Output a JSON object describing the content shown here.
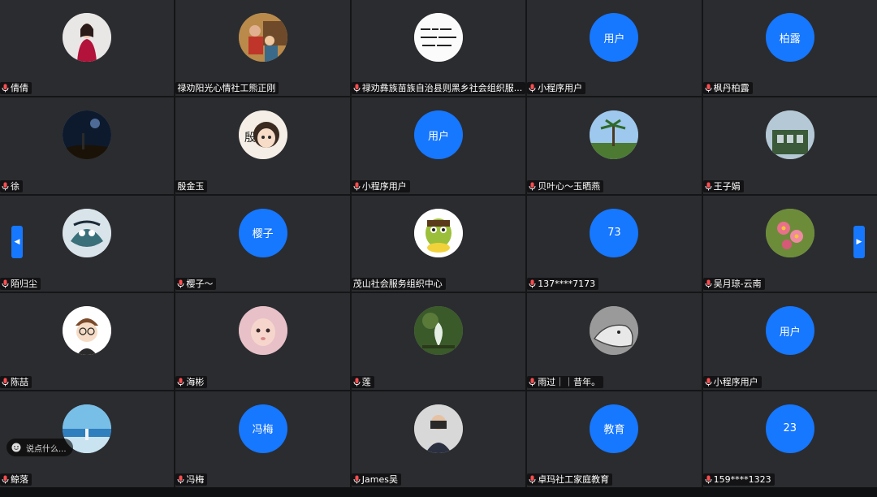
{
  "participants": [
    {
      "name": "倩倩",
      "mic": true,
      "avatar": {
        "kind": "photo",
        "icon": "woman-red-dress-photo"
      }
    },
    {
      "name": "禄劝阳光心情社工熊正刚",
      "mic": false,
      "avatar": {
        "kind": "photo",
        "icon": "people-office-photo"
      }
    },
    {
      "name": "禄劝彝族苗族自治县则黑乡社会组织服...",
      "mic": true,
      "avatar": {
        "kind": "photo",
        "icon": "handwriting-photo"
      }
    },
    {
      "name": "小程序用户",
      "mic": true,
      "avatar": {
        "kind": "text",
        "text": "用户"
      }
    },
    {
      "name": "枫丹柏露",
      "mic": true,
      "avatar": {
        "kind": "text",
        "text": "柏露"
      }
    },
    {
      "name": "徐",
      "mic": true,
      "avatar": {
        "kind": "photo",
        "icon": "night-sky-photo"
      }
    },
    {
      "name": "殷金玉",
      "mic": false,
      "avatar": {
        "kind": "photo",
        "icon": "cartoon-girl-photo"
      }
    },
    {
      "name": "小程序用户",
      "mic": true,
      "avatar": {
        "kind": "text",
        "text": "用户"
      }
    },
    {
      "name": "贝叶心～玉晒燕",
      "mic": true,
      "avatar": {
        "kind": "photo",
        "icon": "palm-tree-photo"
      }
    },
    {
      "name": "王子娟",
      "mic": true,
      "avatar": {
        "kind": "photo",
        "icon": "building-photo"
      }
    },
    {
      "name": "陌归尘",
      "mic": true,
      "avatar": {
        "kind": "photo",
        "icon": "tiger-art-photo"
      }
    },
    {
      "name": "樱子～",
      "mic": true,
      "avatar": {
        "kind": "text",
        "text": "樱子"
      }
    },
    {
      "name": "茂山社会服务组织中心",
      "mic": false,
      "avatar": {
        "kind": "photo",
        "icon": "cartoon-character-photo"
      }
    },
    {
      "name": "137****7173",
      "mic": true,
      "avatar": {
        "kind": "text",
        "text": "73"
      }
    },
    {
      "name": "吴月琼-云南",
      "mic": true,
      "avatar": {
        "kind": "photo",
        "icon": "flowers-photo"
      }
    },
    {
      "name": "陈喆",
      "mic": true,
      "avatar": {
        "kind": "photo",
        "icon": "cartoon-boy-photo"
      }
    },
    {
      "name": "海彬",
      "mic": true,
      "avatar": {
        "kind": "photo",
        "icon": "baby-photo"
      }
    },
    {
      "name": "莲",
      "mic": true,
      "avatar": {
        "kind": "photo",
        "icon": "lotus-photo"
      }
    },
    {
      "name": "雨过｜｜昔年。",
      "mic": true,
      "avatar": {
        "kind": "photo",
        "icon": "seal-sketch-photo"
      }
    },
    {
      "name": "小程序用户",
      "mic": true,
      "avatar": {
        "kind": "text",
        "text": "用户"
      }
    },
    {
      "name": "鲸落",
      "mic": true,
      "avatar": {
        "kind": "photo",
        "icon": "sea-photo"
      }
    },
    {
      "name": "冯梅",
      "mic": true,
      "avatar": {
        "kind": "text",
        "text": "冯梅"
      }
    },
    {
      "name": "James吴",
      "mic": true,
      "avatar": {
        "kind": "photo",
        "icon": "man-camera-photo"
      }
    },
    {
      "name": "卓玛社工家庭教育",
      "mic": true,
      "avatar": {
        "kind": "text",
        "text": "教育"
      }
    },
    {
      "name": "159****1323",
      "mic": true,
      "avatar": {
        "kind": "text",
        "text": "23"
      }
    }
  ],
  "comment": {
    "placeholder": "说点什么..."
  },
  "colors": {
    "accent": "#1677ff",
    "tile": "#2b2c2f",
    "background": "#141516"
  }
}
